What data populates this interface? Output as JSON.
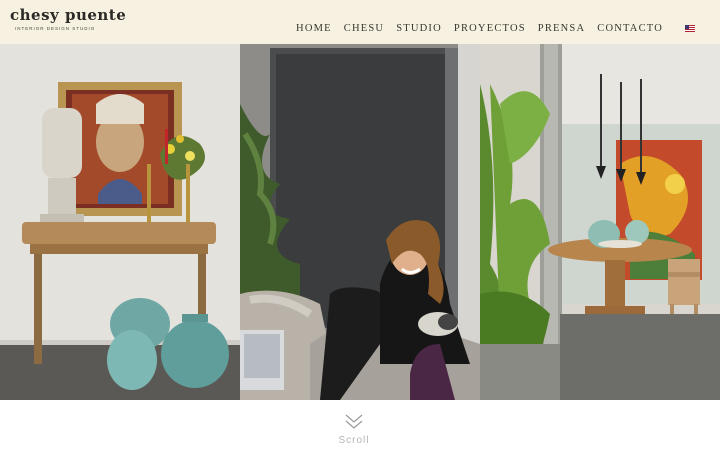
{
  "brand": {
    "name": "chesy puente",
    "tagline": "INTERIOR DESIGN STUDIO"
  },
  "nav": {
    "items": [
      "HOME",
      "CHESU",
      "STUDIO",
      "PROYECTOS",
      "PRENSA",
      "CONTACTO"
    ],
    "language_icon": "us-flag-icon"
  },
  "hero": {
    "images": [
      {
        "icon": "console-table-photo"
      },
      {
        "icon": "designer-portrait-photo"
      },
      {
        "icon": "dining-room-photo"
      }
    ]
  },
  "scroll": {
    "label": "Scroll",
    "icon": "double-chevron-down-icon"
  },
  "colors": {
    "header_bg": "#f6f1e1",
    "nav_text": "#3a3630",
    "scroll_text": "#b5b5b5"
  }
}
